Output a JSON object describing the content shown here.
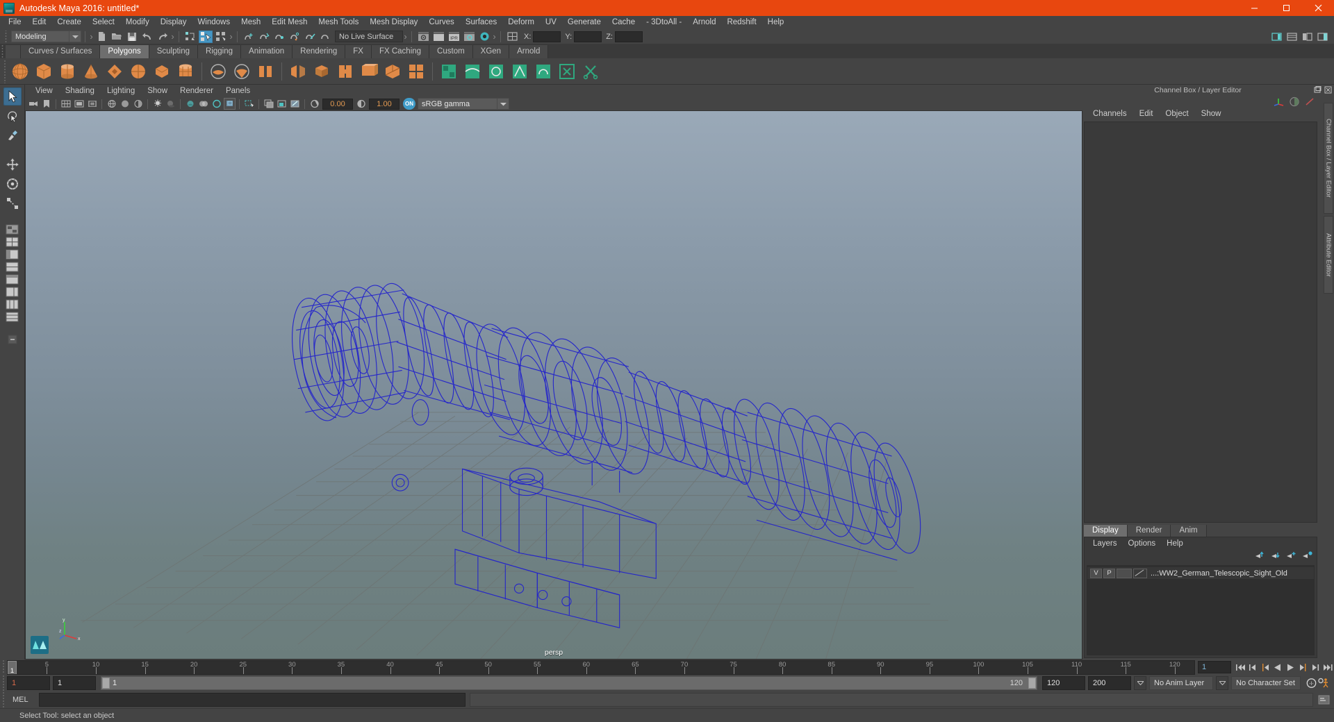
{
  "titlebar": {
    "app_title": "Autodesk Maya 2016: untitled*",
    "logo_icon": "maya-logo-icon",
    "minimize_icon": "minimize-icon",
    "maximize_icon": "maximize-icon",
    "close_icon": "close-icon",
    "accent_color": "#e8470f"
  },
  "menubar": {
    "items": [
      "File",
      "Edit",
      "Create",
      "Select",
      "Modify",
      "Display",
      "Windows",
      "Mesh",
      "Edit Mesh",
      "Mesh Tools",
      "Mesh Display",
      "Curves",
      "Surfaces",
      "Deform",
      "UV",
      "Generate",
      "Cache",
      "- 3DtoAll -",
      "Arnold",
      "Redshift",
      "Help"
    ]
  },
  "statusline": {
    "mode_label": "Modeling",
    "mode_arrow_icon": "chevron-down-icon",
    "live_surface_label": "No Live Surface",
    "coord_x_label": "X:",
    "coord_y_label": "Y:",
    "coord_z_label": "Z:",
    "coord_x_value": "",
    "coord_y_value": "",
    "coord_z_value": "",
    "icons": [
      "new-scene-icon",
      "open-scene-icon",
      "save-scene-icon",
      "undo-icon",
      "redo-icon",
      "select-hierarchy-icon",
      "select-object-icon",
      "select-component-icon",
      "snap-grid-icon",
      "snap-curve-icon",
      "snap-point-icon",
      "snap-projected-icon",
      "snap-view-plane-icon",
      "make-live-icon",
      "render-view-icon",
      "render-current-frame-icon",
      "ipr-render-icon",
      "render-settings-icon",
      "hypershade-icon",
      "editor-layout-icon"
    ],
    "right_icons": [
      "sidebar-toggle-icon",
      "attribute-editor-icon",
      "tool-settings-icon",
      "channel-box-icon"
    ]
  },
  "shelf": {
    "tabs": [
      {
        "label": "Curves / Surfaces",
        "active": false
      },
      {
        "label": "Polygons",
        "active": true
      },
      {
        "label": "Sculpting",
        "active": false
      },
      {
        "label": "Rigging",
        "active": false
      },
      {
        "label": "Animation",
        "active": false
      },
      {
        "label": "Rendering",
        "active": false
      },
      {
        "label": "FX",
        "active": false
      },
      {
        "label": "FX Caching",
        "active": false
      },
      {
        "label": "Custom",
        "active": false
      },
      {
        "label": "XGen",
        "active": false
      },
      {
        "label": "Arnold",
        "active": false
      }
    ],
    "icon_color": "#e08a48",
    "icons": [
      "poly-sphere-icon",
      "poly-cube-icon",
      "poly-cylinder-icon",
      "poly-cone-icon",
      "poly-torus-icon",
      "poly-plane-icon",
      "poly-disc-icon",
      "poly-platonic-icon",
      "poly-sphere-sculpt-icon",
      "poly-combine-icon",
      "poly-booleans-icon",
      "poly-mirror-icon",
      "poly-extrude-icon",
      "poly-bevel-icon",
      "poly-bridge-icon",
      "poly-append-icon",
      "poly-wedge-icon",
      "poly-duplicate-icon",
      "poly-smooth-icon",
      "poly-triangulate-icon",
      "poly-quadrangulate-icon",
      "poly-reduce-icon",
      "uv-planar-icon",
      "uv-cylindrical-icon",
      "uv-spherical-icon",
      "uv-automatic-icon",
      "uv-camera-icon",
      "uv-layout-icon",
      "uv-cut-icon"
    ]
  },
  "toolbox": {
    "items": [
      {
        "name": "select-tool",
        "selected": true
      },
      {
        "name": "lasso-tool",
        "selected": false
      },
      {
        "name": "paint-select-tool",
        "selected": false
      },
      {
        "name": "move-tool",
        "selected": false
      },
      {
        "name": "rotate-tool",
        "selected": false
      },
      {
        "name": "scale-tool",
        "selected": false
      },
      {
        "name": "last-tool",
        "selected": false
      }
    ],
    "layout_icons": [
      "single-perspective-layout-icon",
      "four-view-layout-icon",
      "outliner-persp-layout-icon",
      "persp-graph-layout-icon",
      "hypershade-persp-layout-icon",
      "persp-uv-layout-icon",
      "two-stacked-layout-icon",
      "three-pane-layout-icon"
    ],
    "view_cube_icon": "maya-view-cube-icon"
  },
  "viewport": {
    "menu_items": [
      "View",
      "Shading",
      "Lighting",
      "Show",
      "Renderer",
      "Panels"
    ],
    "toolbar_icons": [
      "select-camera-icon",
      "bookmark-icon",
      "image-plane-icon",
      "grid-toggle-icon",
      "film-gate-icon",
      "resolution-gate-icon",
      "gate-mask-icon",
      "xray-icon",
      "xray-joints-icon",
      "xray-active-components-icon",
      "wireframe-icon",
      "smooth-shade-all-icon",
      "smooth-shade-selected-icon",
      "flat-shade-icon",
      "shaded-wireframe-icon",
      "textured-icon",
      "lighting-icon",
      "shadows-icon",
      "ao-icon",
      "motion-blur-icon",
      "isolate-select-icon",
      "display-hud-icon",
      "pane-toggle-icon",
      "snapshot-icon",
      "viewport-settings-icon"
    ],
    "exposure_value": "0.00",
    "gamma_value": "1.00",
    "color_mgmt_toggle": "ON",
    "color_profile": "sRGB gamma",
    "color_profile_arrow_icon": "chevron-down-icon",
    "camera_label": "persp",
    "axis_labels": {
      "x": "x",
      "y": "y",
      "z": "z"
    },
    "model": {
      "name": "WW2 German Telescopic Sight wireframe",
      "wire_color": "#2222cc",
      "grid_color": "#6a6f6a"
    }
  },
  "rightpanel": {
    "panel_title": "Channel Box / Layer Editor",
    "undock_icon": "undock-icon",
    "close_icon": "close-icon",
    "top_icons": [
      "transform-axes-icon",
      "shading-sphere-icon",
      "render-stats-icon"
    ],
    "channelbox_menu": [
      "Channels",
      "Edit",
      "Object",
      "Show"
    ],
    "side_tabs": [
      "Channel Box / Layer Editor",
      "Attribute Editor"
    ],
    "layer_tabs": [
      {
        "label": "Display",
        "active": true
      },
      {
        "label": "Render",
        "active": false
      },
      {
        "label": "Anim",
        "active": false
      }
    ],
    "layer_menu": [
      "Layers",
      "Options",
      "Help"
    ],
    "layer_icons": [
      "move-layer-up-icon",
      "move-layer-down-icon",
      "new-layer-icon",
      "new-layer-from-selected-icon"
    ],
    "layers": [
      {
        "visibility": "V",
        "playback": "P",
        "type": "",
        "swatch_icon": "layer-color-swatch-icon",
        "name": "...:WW2_German_Telescopic_Sight_Old"
      }
    ]
  },
  "timeslider": {
    "current_frame": "1",
    "cursor_label": "1",
    "ticks": [
      5,
      10,
      15,
      20,
      25,
      30,
      35,
      40,
      45,
      50,
      55,
      60,
      65,
      70,
      75,
      80,
      85,
      90,
      95,
      100,
      105,
      110,
      115,
      120
    ],
    "start": 1,
    "end": 122,
    "end_label": "120",
    "playback_buttons": [
      "go-to-start-icon",
      "step-back-keyframe-icon",
      "step-back-frame-icon",
      "play-backwards-icon",
      "play-forwards-icon",
      "step-forward-frame-icon",
      "step-forward-keyframe-icon",
      "go-to-end-icon"
    ]
  },
  "rangeslider": {
    "anim_start": "1",
    "playback_start": "1",
    "range_start_label": "1",
    "range_end_label": "120",
    "playback_end": "120",
    "anim_end": "200",
    "anim_layer": "No Anim Layer",
    "character_set": "No Character Set",
    "anim_layer_arrow_icon": "chevron-down-icon",
    "character_set_arrow_icon": "chevron-down-icon",
    "auto_key_icon": "auto-keyframe-icon",
    "anim_prefs_icon": "animation-preferences-icon"
  },
  "commandline": {
    "mel_label": "MEL",
    "command_value": "",
    "output_value": "",
    "script_editor_icon": "script-editor-icon"
  },
  "helpline": {
    "text": "Select Tool: select an object"
  }
}
